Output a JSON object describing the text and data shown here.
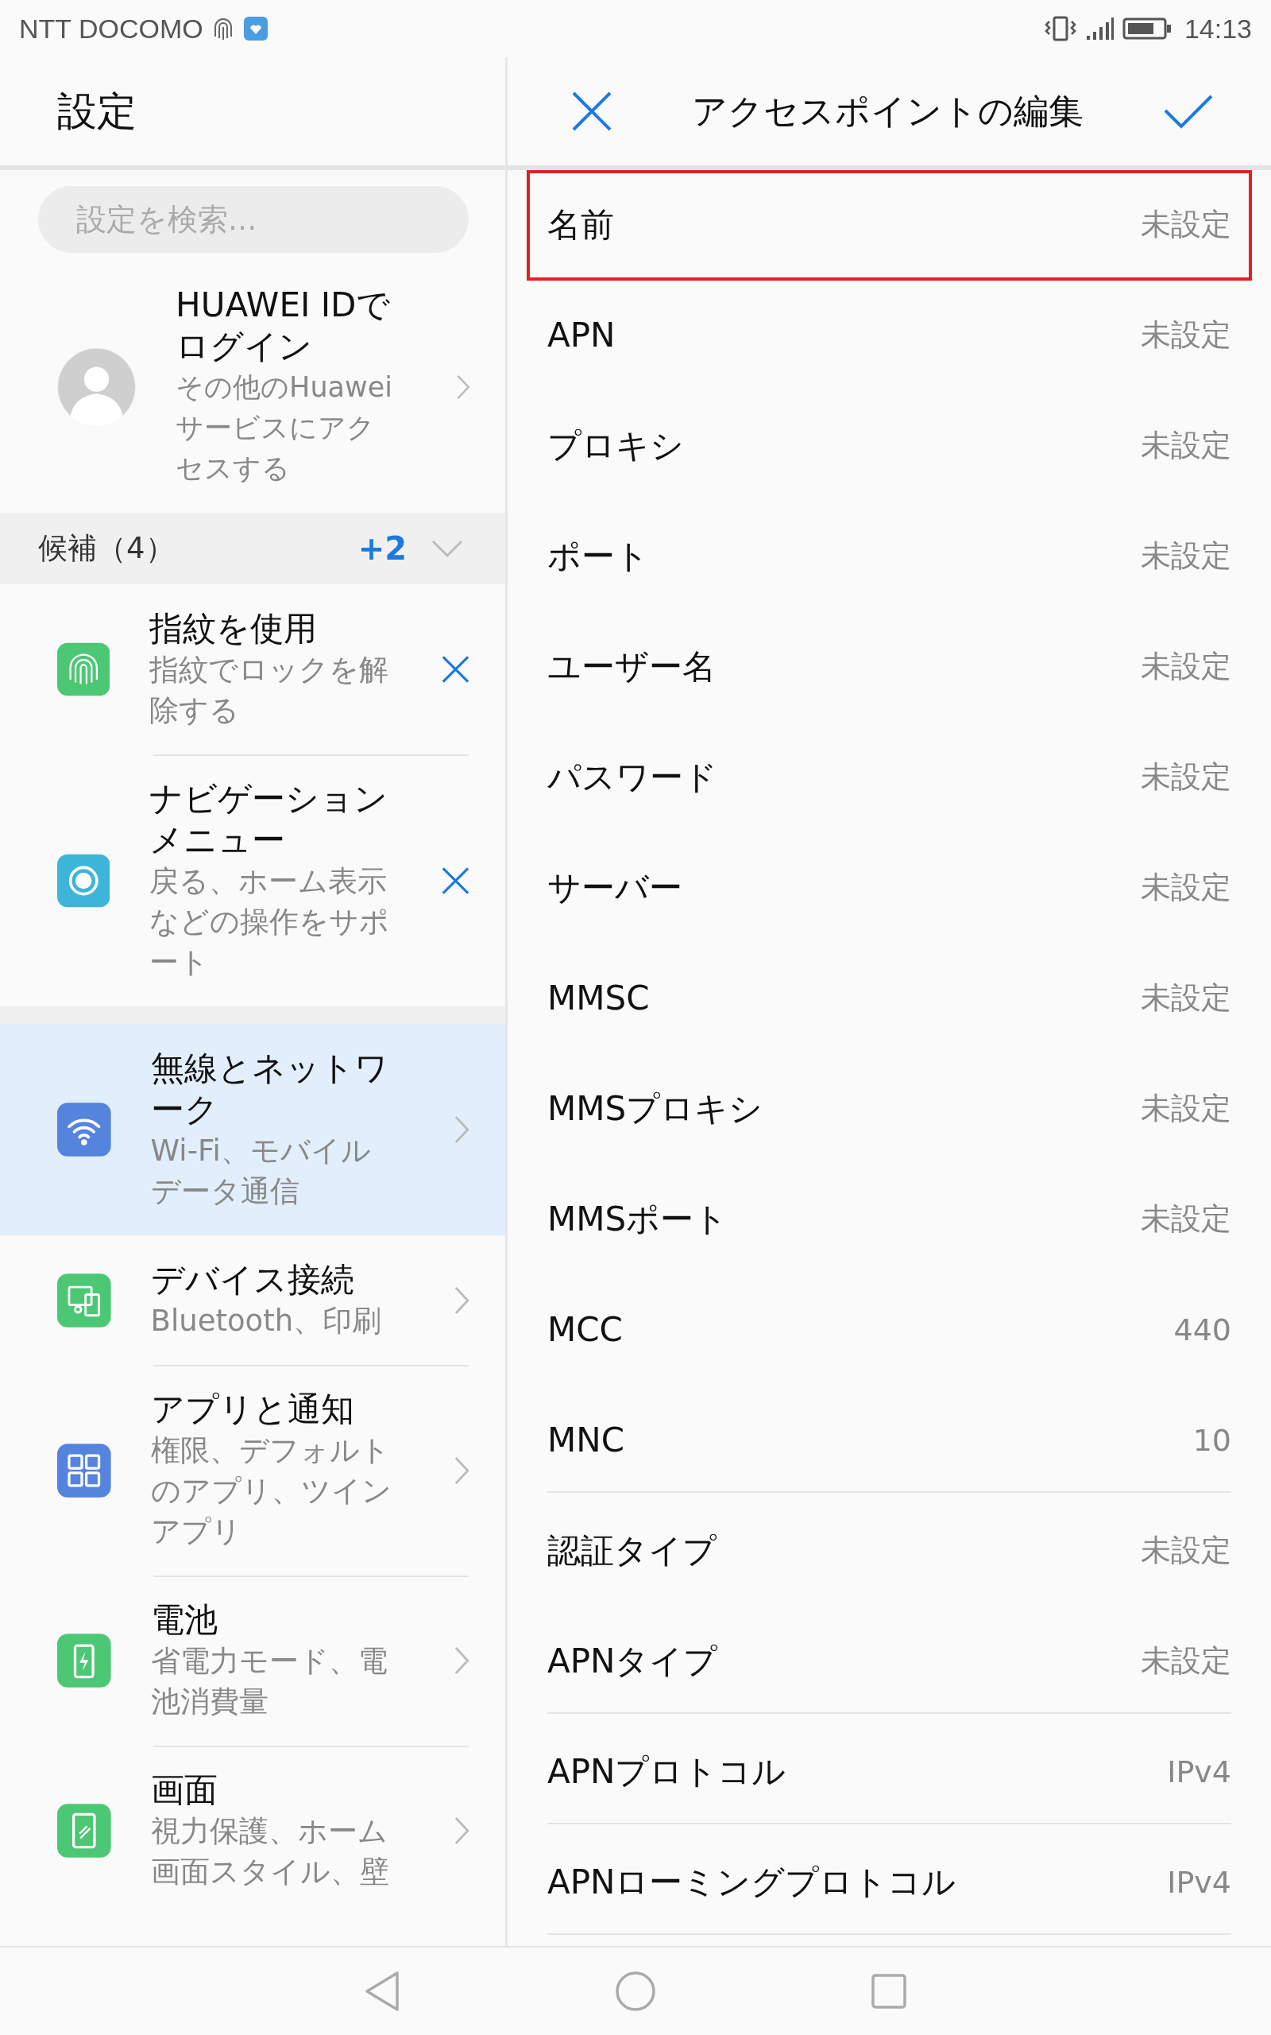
{
  "status_bar": {
    "carrier": "NTT DOCOMO",
    "time": "14:13"
  },
  "settings_panel": {
    "title": "設定",
    "search": {
      "placeholder": "設定を検索..."
    },
    "profile": {
      "title": "HUAWEI IDでログイン",
      "subtitle": "その他のHuaweiサービスにアクセスする"
    },
    "suggestions_header": {
      "label": "候補（4）",
      "extra": "+2",
      "expanded": false
    },
    "suggestions": [
      {
        "title": "指紋を使用",
        "subtitle": "指紋でロックを解除する",
        "color": "#4cc774"
      },
      {
        "title": "ナビゲーションメニュー",
        "subtitle": "戻る、ホーム表示などの操作をサポート",
        "color": "#3db5d9"
      }
    ],
    "items": [
      {
        "title": "無線とネットワーク",
        "subtitle": "Wi-Fi、モバイルデータ通信",
        "color": "#5584de",
        "selected": true
      },
      {
        "title": "デバイス接続",
        "subtitle": "Bluetooth、印刷",
        "color": "#4cc774",
        "selected": false
      },
      {
        "title": "アプリと通知",
        "subtitle": "権限、デフォルトのアプリ、ツインアプリ",
        "color": "#5584de",
        "selected": false
      },
      {
        "title": "電池",
        "subtitle": "省電力モード、電池消費量",
        "color": "#4cc774",
        "selected": false
      },
      {
        "title": "画面",
        "subtitle": "視力保護、ホーム画面スタイル、壁",
        "color": "#4cc774",
        "selected": false
      }
    ]
  },
  "apn_panel": {
    "title": "アクセスポイントの編集",
    "fields": [
      {
        "label": "名前",
        "value": "未設定",
        "selected": true,
        "separated": false
      },
      {
        "label": "APN",
        "value": "未設定",
        "selected": false,
        "separated": false
      },
      {
        "label": "プロキシ",
        "value": "未設定",
        "selected": false,
        "separated": false
      },
      {
        "label": "ポート",
        "value": "未設定",
        "selected": false,
        "separated": false
      },
      {
        "label": "ユーザー名",
        "value": "未設定",
        "selected": false,
        "separated": false
      },
      {
        "label": "パスワード",
        "value": "未設定",
        "selected": false,
        "separated": false
      },
      {
        "label": "サーバー",
        "value": "未設定",
        "selected": false,
        "separated": false
      },
      {
        "label": "MMSC",
        "value": "未設定",
        "selected": false,
        "separated": false
      },
      {
        "label": "MMSプロキシ",
        "value": "未設定",
        "selected": false,
        "separated": false
      },
      {
        "label": "MMSポート",
        "value": "未設定",
        "selected": false,
        "separated": false
      },
      {
        "label": "MCC",
        "value": "440",
        "selected": false,
        "separated": false
      },
      {
        "label": "MNC",
        "value": "10",
        "selected": false,
        "separated": true
      },
      {
        "label": "認証タイプ",
        "value": "未設定",
        "selected": false,
        "separated": false
      },
      {
        "label": "APNタイプ",
        "value": "未設定",
        "selected": false,
        "separated": true
      },
      {
        "label": "APNプロトコル",
        "value": "IPv4",
        "selected": false,
        "separated": true
      },
      {
        "label": "APNローミングプロトコル",
        "value": "IPv4",
        "selected": false,
        "separated": true
      }
    ]
  }
}
